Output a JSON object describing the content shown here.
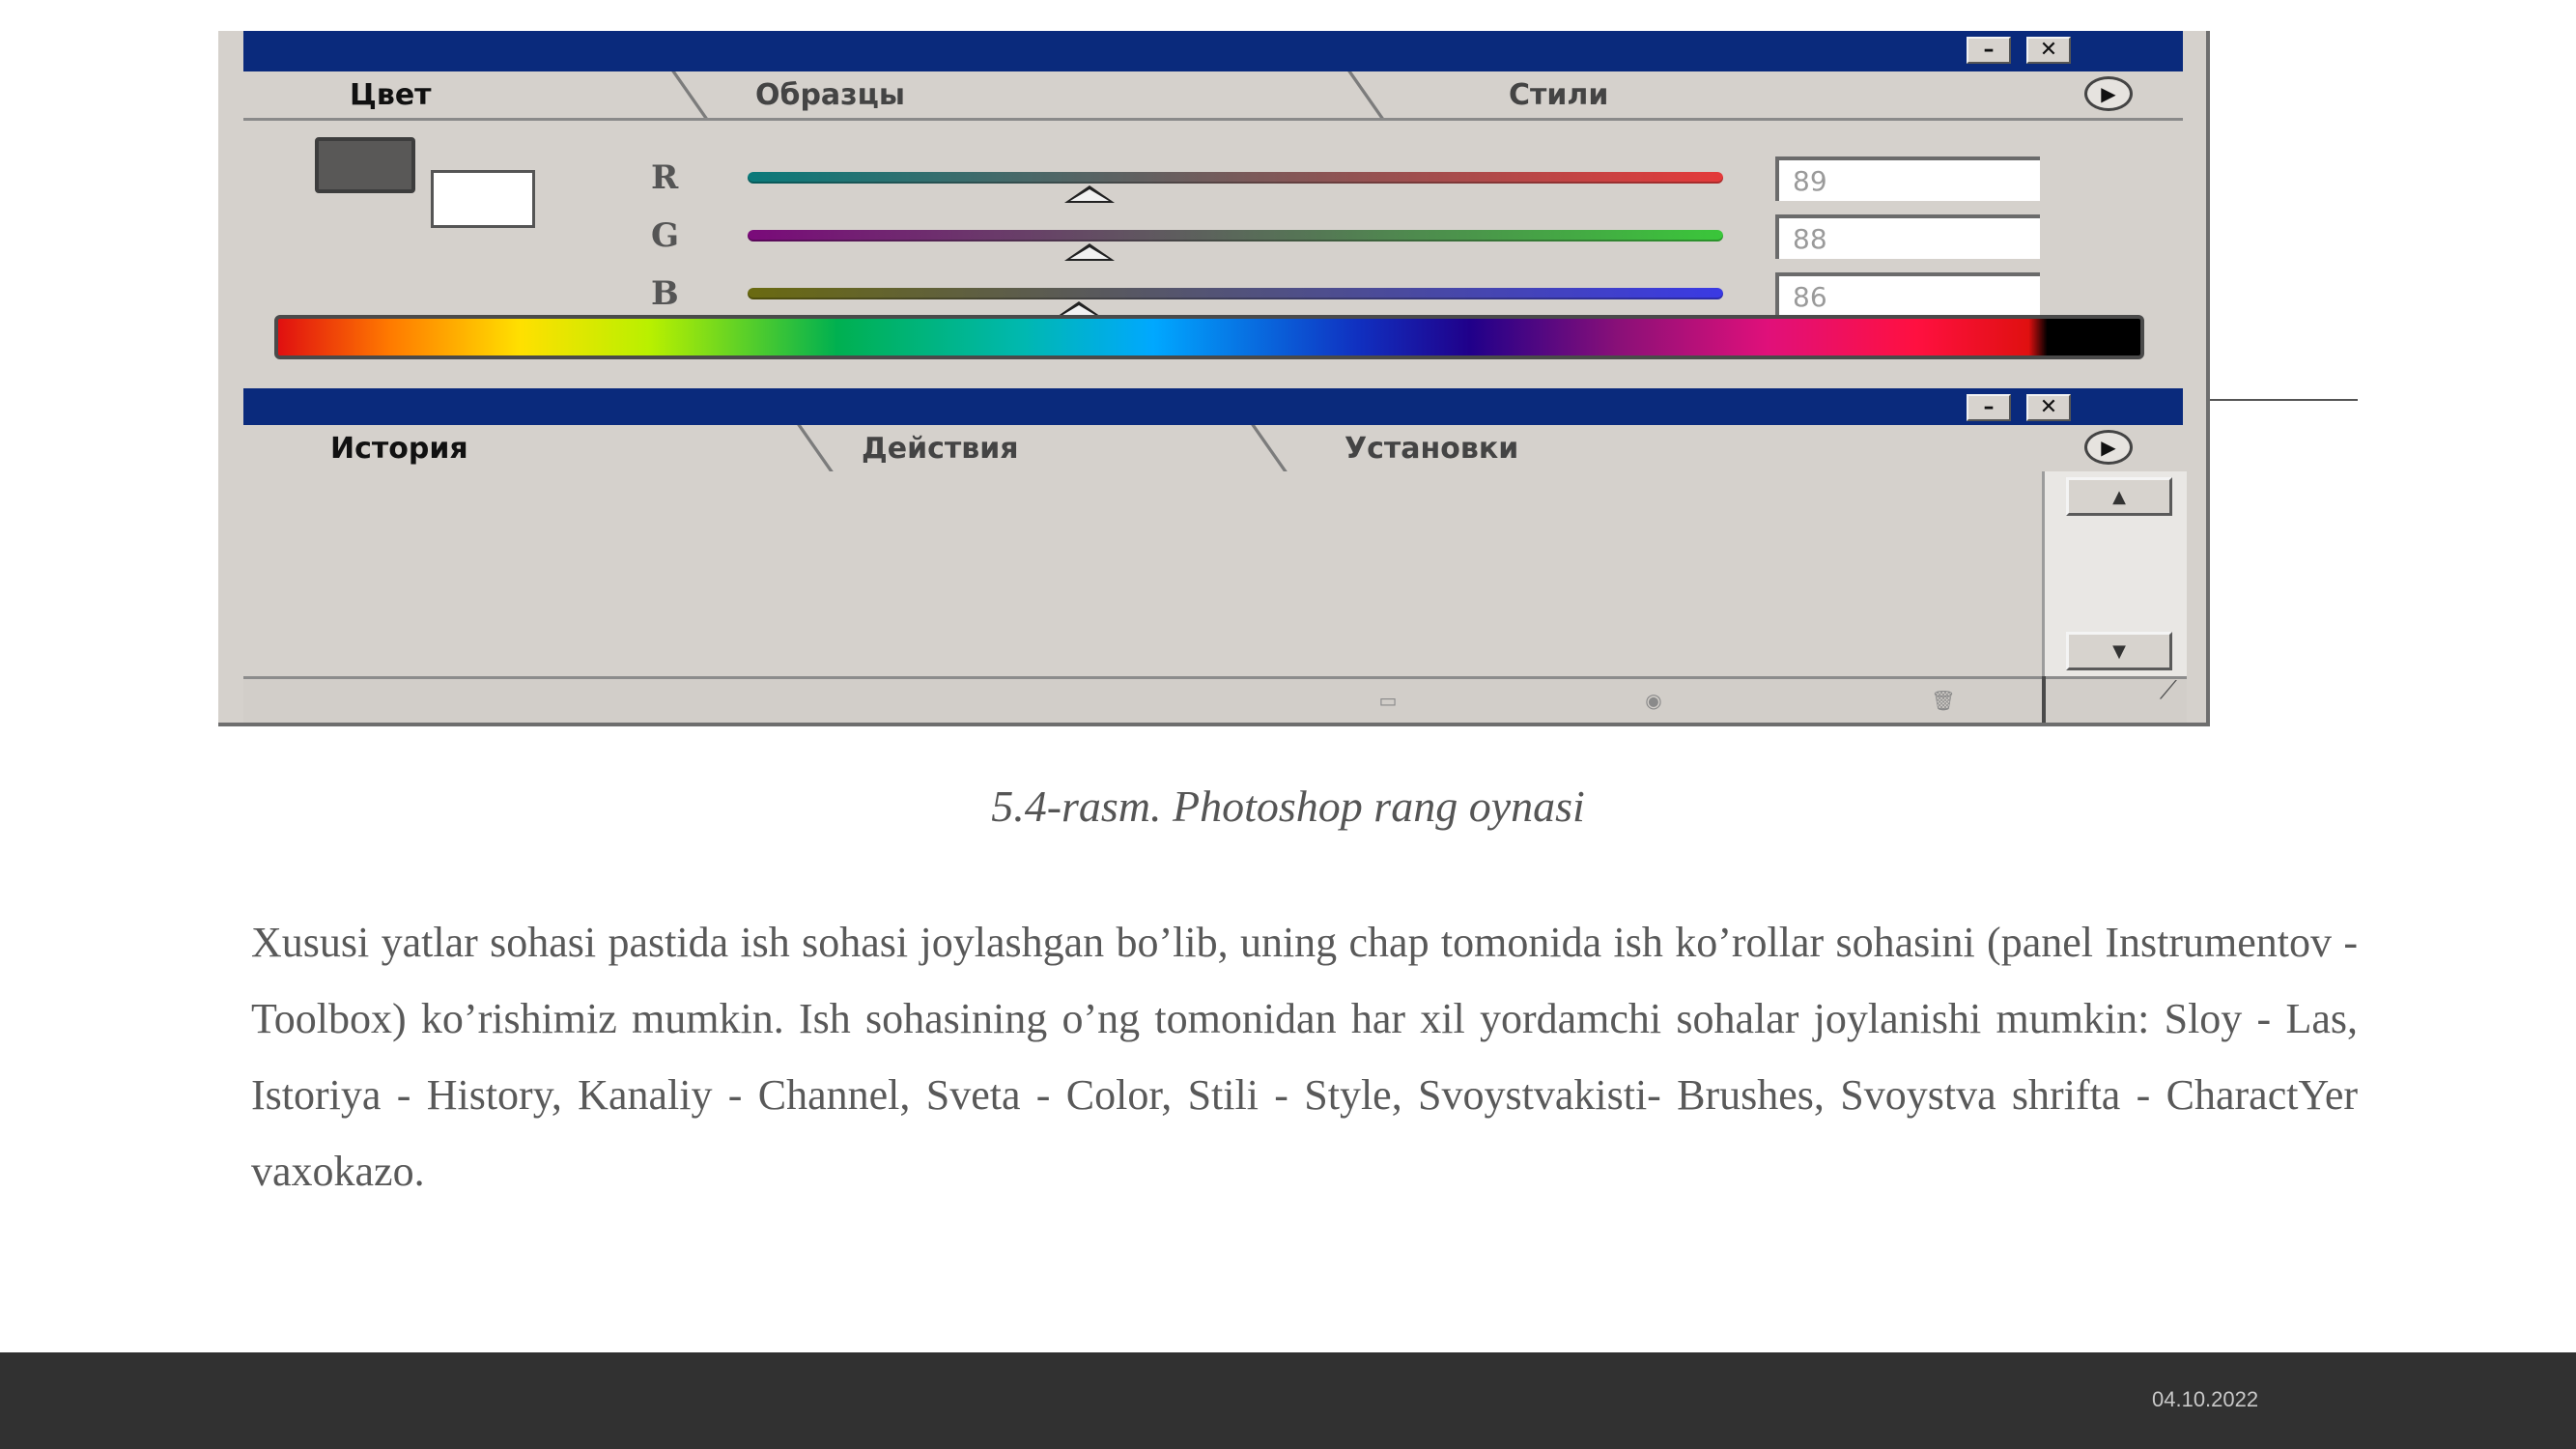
{
  "color_panel": {
    "tabs": [
      "Цвет",
      "Образцы",
      "Стили"
    ],
    "channels": [
      {
        "label": "R",
        "value": "89",
        "level": 0.35,
        "track": [
          "#0a7a7a",
          "#e43a3a"
        ]
      },
      {
        "label": "G",
        "value": "88",
        "level": 0.35,
        "track": [
          "#7a0a7a",
          "#3ac63a"
        ]
      },
      {
        "label": "B",
        "value": "86",
        "level": 0.34,
        "track": [
          "#6a6a10",
          "#3a3ae4"
        ]
      }
    ]
  },
  "history_panel": {
    "tabs": [
      "История",
      "Действия",
      "Установки"
    ]
  },
  "caption": "5.4-rasm. Photoshop rang oynasi",
  "body_text": "Xususi yatlar sohasi pastida ish sohasi joylashgan bo’lib, uning chap tomonida ish ko’rollar sohasini (panel Instrumentov - Toolbox) ko’rishimiz mumkin. Ish sohasining o’ng tomonidan har xil yordamchi sohalar joylanishi mumkin: Sloy - Las, Istoriya - History, Kanaliy - Channel, Sveta - Color, Stili - Style, Svoystvakisti- Brushes, Svoystva shrifta - CharactYer vaxokazo.",
  "footer": {
    "date": "04.10.2022"
  },
  "colors": {
    "titlebar": "#0a2a7c",
    "panel_bg": "#d5d1cc",
    "footer_bg": "#313131",
    "text": "#595959"
  }
}
